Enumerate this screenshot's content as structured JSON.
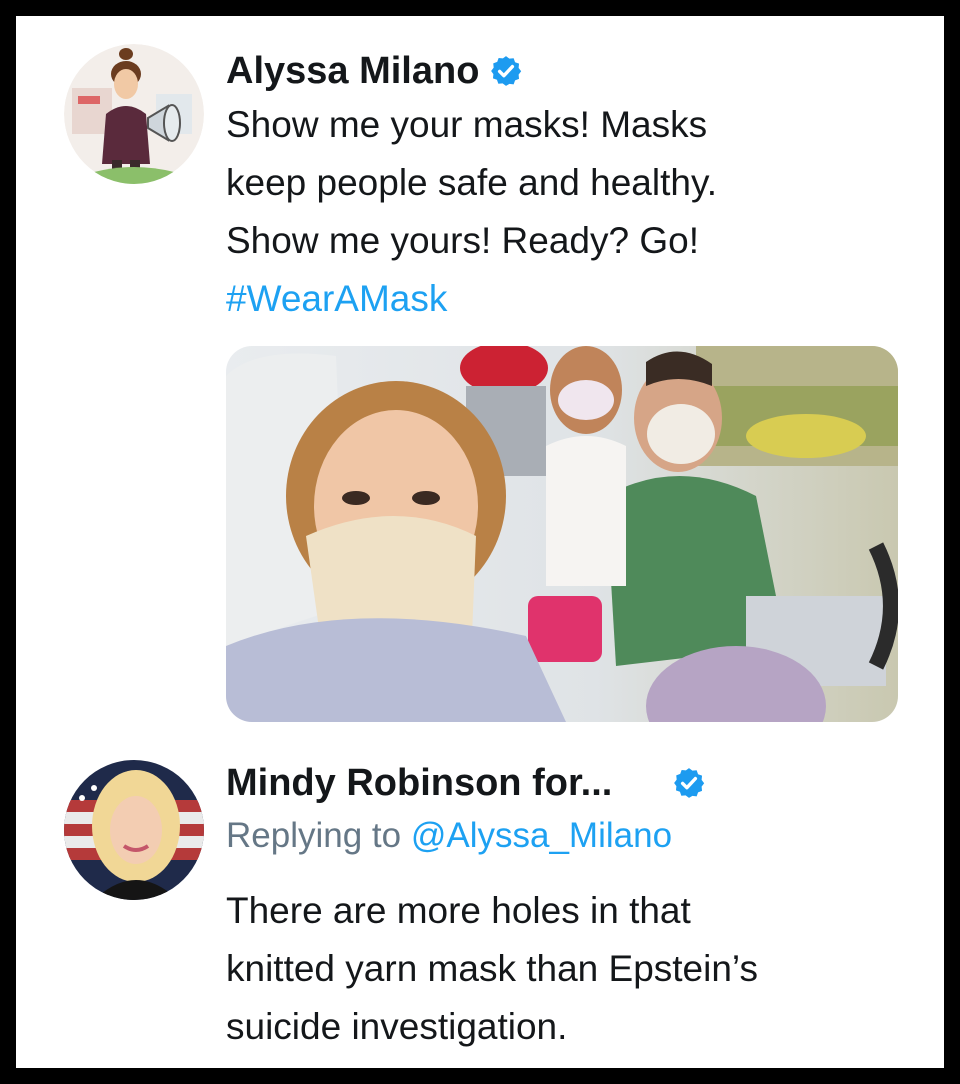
{
  "tweet": {
    "author_name": "Alyssa Milano",
    "verified_icon": "verified-badge-icon",
    "text_lines": [
      "Show me your masks! Masks",
      "keep people safe and healthy.",
      "Show me yours! Ready? Go!"
    ],
    "hashtag": "#WearAMask",
    "avatar_icon": "cartoon-avatar-megaphone",
    "photo": "selfie-in-car-family-wearing-masks"
  },
  "reply": {
    "author_name": "Mindy Robinson for...",
    "verified_icon": "verified-badge-icon",
    "replying_prefix": "Replying to",
    "replying_handle": "@Alyssa_Milano",
    "text_lines": [
      "There are more holes in that",
      "knitted yarn mask than Epstein’s",
      "suicide investigation."
    ],
    "avatar_icon": "woman-portrait-flag-avatar"
  },
  "colors": {
    "link_blue": "#1da1f2",
    "verified_blue": "#1d9bf0",
    "text_dark": "#14171a",
    "text_gray": "#657786",
    "frame": "#000000"
  }
}
